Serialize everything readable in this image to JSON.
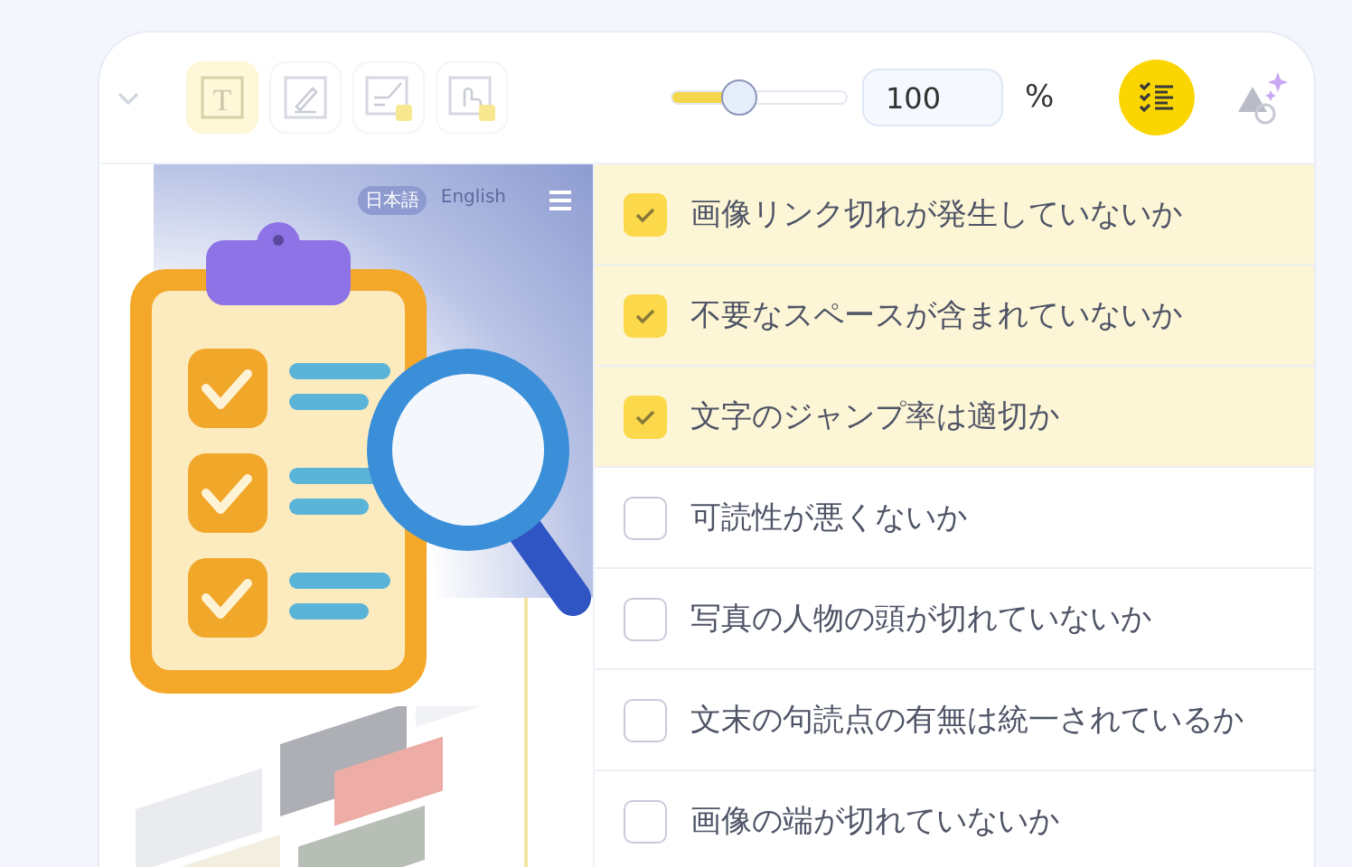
{
  "toolbar": {
    "tools": [
      {
        "kind": "text",
        "glyph": "T",
        "selected": true
      },
      {
        "kind": "draw",
        "selected": false
      },
      {
        "kind": "stamp",
        "selected": false
      },
      {
        "kind": "touch",
        "selected": false
      }
    ],
    "zoom": {
      "level": 0.36,
      "value": "100",
      "unit": "%"
    },
    "checklist_button": {
      "on": true
    }
  },
  "preview": {
    "languages": [
      {
        "label": "日本語",
        "selected": true
      },
      {
        "label": "English",
        "selected": false
      }
    ]
  },
  "checklist": [
    {
      "label": "画像リンク切れが発生していないか",
      "checked": true
    },
    {
      "label": "不要なスペースが含まれていないか",
      "checked": true
    },
    {
      "label": "文字のジャンプ率は適切か",
      "checked": true
    },
    {
      "label": "可読性が悪くないか",
      "checked": false
    },
    {
      "label": "写真の人物の頭が切れていないか",
      "checked": false
    },
    {
      "label": "文末の句読点の有無は統一されているか",
      "checked": false
    },
    {
      "label": "画像の端が切れていないか",
      "checked": false
    }
  ]
}
